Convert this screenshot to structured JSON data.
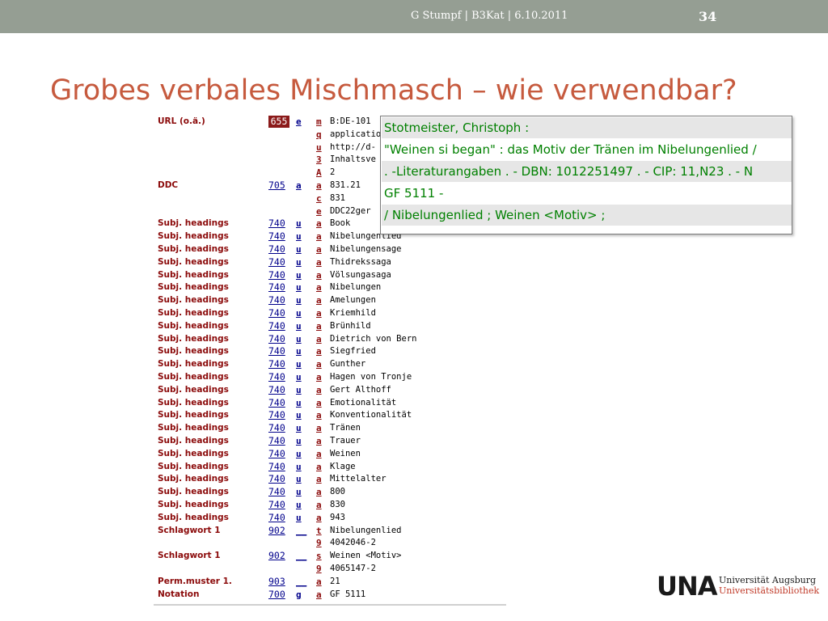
{
  "header": {
    "meta": "G Stumpf  |  B3Kat  |  6.10.2011",
    "page_number": "34"
  },
  "title": "Grobes verbales Mischmasch – wie verwendbar?",
  "marc": [
    {
      "label": "URL (o.ä.)",
      "tag": "655",
      "ind": "e",
      "sub": "m",
      "value": "B:DE-101",
      "hl": true
    },
    {
      "label": "",
      "tag": "",
      "ind": "",
      "sub": "q",
      "value": "application"
    },
    {
      "label": "",
      "tag": "",
      "ind": "",
      "sub": "u",
      "value": "http://d-"
    },
    {
      "label": "",
      "tag": "",
      "ind": "",
      "sub": "3",
      "value": "Inhaltsve"
    },
    {
      "label": "",
      "tag": "",
      "ind": "",
      "sub": "A",
      "value": "2"
    },
    {
      "label": "DDC",
      "tag": "705",
      "ind": "a",
      "sub": "a",
      "value": "831.21"
    },
    {
      "label": "",
      "tag": "",
      "ind": "",
      "sub": "c",
      "value": "831"
    },
    {
      "label": "",
      "tag": "",
      "ind": "",
      "sub": "e",
      "value": "DDC22ger"
    },
    {
      "label": "Subj. headings",
      "tag": "740",
      "ind": "u",
      "sub": "a",
      "value": "Book"
    },
    {
      "label": "Subj. headings",
      "tag": "740",
      "ind": "u",
      "sub": "a",
      "value": "Nibelungenlied"
    },
    {
      "label": "Subj. headings",
      "tag": "740",
      "ind": "u",
      "sub": "a",
      "value": "Nibelungensage"
    },
    {
      "label": "Subj. headings",
      "tag": "740",
      "ind": "u",
      "sub": "a",
      "value": "Thidrekssaga"
    },
    {
      "label": "Subj. headings",
      "tag": "740",
      "ind": "u",
      "sub": "a",
      "value": "Völsungasaga"
    },
    {
      "label": "Subj. headings",
      "tag": "740",
      "ind": "u",
      "sub": "a",
      "value": "Nibelungen"
    },
    {
      "label": "Subj. headings",
      "tag": "740",
      "ind": "u",
      "sub": "a",
      "value": "Amelungen"
    },
    {
      "label": "Subj. headings",
      "tag": "740",
      "ind": "u",
      "sub": "a",
      "value": "Kriemhild"
    },
    {
      "label": "Subj. headings",
      "tag": "740",
      "ind": "u",
      "sub": "a",
      "value": "Brünhild"
    },
    {
      "label": "Subj. headings",
      "tag": "740",
      "ind": "u",
      "sub": "a",
      "value": "Dietrich von Bern"
    },
    {
      "label": "Subj. headings",
      "tag": "740",
      "ind": "u",
      "sub": "a",
      "value": "Siegfried"
    },
    {
      "label": "Subj. headings",
      "tag": "740",
      "ind": "u",
      "sub": "a",
      "value": "Gunther"
    },
    {
      "label": "Subj. headings",
      "tag": "740",
      "ind": "u",
      "sub": "a",
      "value": "Hagen von Tronje"
    },
    {
      "label": "Subj. headings",
      "tag": "740",
      "ind": "u",
      "sub": "a",
      "value": "Gert Althoff"
    },
    {
      "label": "Subj. headings",
      "tag": "740",
      "ind": "u",
      "sub": "a",
      "value": "Emotionalität"
    },
    {
      "label": "Subj. headings",
      "tag": "740",
      "ind": "u",
      "sub": "a",
      "value": "Konventionalität"
    },
    {
      "label": "Subj. headings",
      "tag": "740",
      "ind": "u",
      "sub": "a",
      "value": "Tränen"
    },
    {
      "label": "Subj. headings",
      "tag": "740",
      "ind": "u",
      "sub": "a",
      "value": "Trauer"
    },
    {
      "label": "Subj. headings",
      "tag": "740",
      "ind": "u",
      "sub": "a",
      "value": "Weinen"
    },
    {
      "label": "Subj. headings",
      "tag": "740",
      "ind": "u",
      "sub": "a",
      "value": "Klage"
    },
    {
      "label": "Subj. headings",
      "tag": "740",
      "ind": "u",
      "sub": "a",
      "value": "Mittelalter"
    },
    {
      "label": "Subj. headings",
      "tag": "740",
      "ind": "u",
      "sub": "a",
      "value": "800"
    },
    {
      "label": "Subj. headings",
      "tag": "740",
      "ind": "u",
      "sub": "a",
      "value": "830"
    },
    {
      "label": "Subj. headings",
      "tag": "740",
      "ind": "u",
      "sub": "a",
      "value": "943"
    },
    {
      "label": "Schlagwort 1",
      "tag": "902",
      "ind": "__",
      "sub": "t",
      "value": "Nibelungenlied"
    },
    {
      "label": "",
      "tag": "",
      "ind": "",
      "sub": "9",
      "value": "4042046-2"
    },
    {
      "label": "Schlagwort 1",
      "tag": "902",
      "ind": "__",
      "sub": "s",
      "value": "Weinen <Motiv>"
    },
    {
      "label": "",
      "tag": "",
      "ind": "",
      "sub": "9",
      "value": "4065147-2"
    },
    {
      "label": "Perm.muster 1.",
      "tag": "903",
      "ind": "__",
      "sub": "a",
      "value": "21"
    },
    {
      "label": "Notation",
      "tag": "700",
      "ind": "g",
      "sub": "a",
      "value": "GF 5111"
    }
  ],
  "popup": {
    "lines": [
      "Stotmeister, Christoph :",
      "\"Weinen si began\" : das Motiv der Tränen im Nibelungenlied /",
      ". -Literaturangaben . - DBN: 1012251497 . - CIP: 11,N23 . - N",
      "GF 5111  -",
      "/ Nibelungenlied  ; Weinen <Motiv>  ;"
    ]
  },
  "logo": {
    "mark": "UNA",
    "line1": "Universität Augsburg",
    "line2": "Universitätsbibliothek"
  },
  "colors": {
    "header_bg": "#959e93",
    "title": "#c65a3e",
    "label": "#8b0a0a",
    "tag": "#00008b",
    "popup_text": "#008000"
  }
}
